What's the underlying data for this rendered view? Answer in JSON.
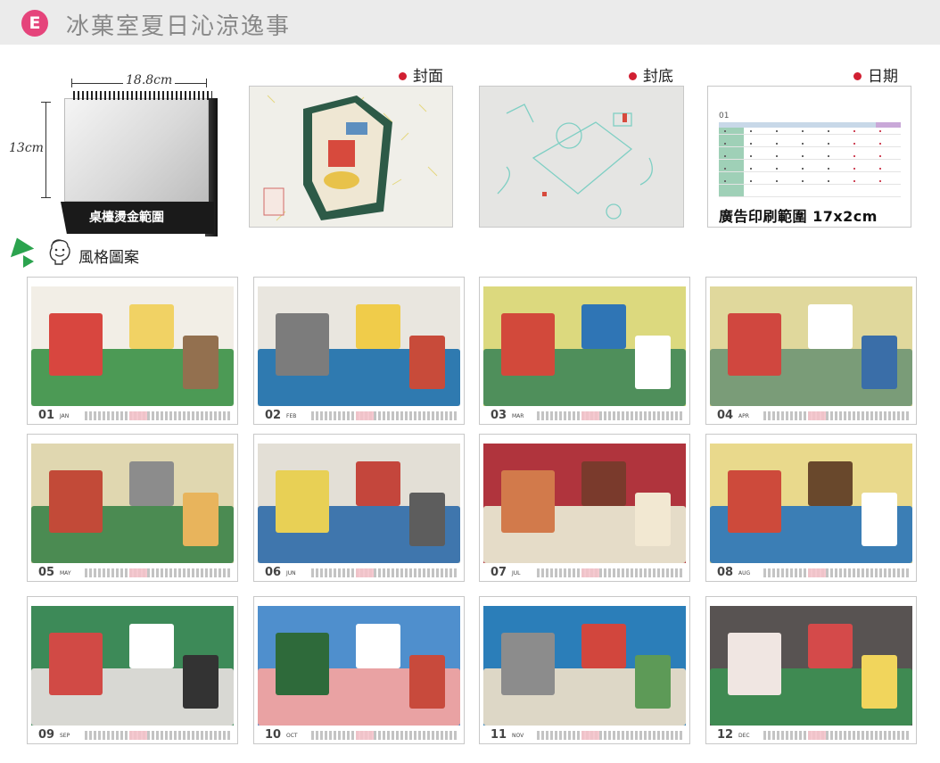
{
  "header": {
    "badge": "E",
    "title": "冰菓室夏日沁涼逸事",
    "badge_color": "#e5447b"
  },
  "desk": {
    "width_label": "18.8cm",
    "height_label": "13cm",
    "base_label": "桌檯燙金範圍"
  },
  "style_section": {
    "label": "風格圖案",
    "icon": "smiley-face-icon"
  },
  "previews": {
    "cover": {
      "label": "封面"
    },
    "back": {
      "label": "封底"
    },
    "date": {
      "label": "日期",
      "mini_month": "01",
      "range_label": "廣告印刷範圍 17x2cm"
    }
  },
  "months": [
    {
      "num": "01",
      "name": "JAN",
      "bg": "#f2eee6",
      "c1": "#4c9a55",
      "c2": "#d8463f",
      "c3": "#f1d264",
      "c4": "#93704f"
    },
    {
      "num": "02",
      "name": "FEB",
      "bg": "#e9e6df",
      "c1": "#2f7ab0",
      "c2": "#7c7c7c",
      "c3": "#f0cc4a",
      "c4": "#c84b3a"
    },
    {
      "num": "03",
      "name": "MAR",
      "bg": "#dcd97e",
      "c1": "#4f8f5b",
      "c2": "#d2493b",
      "c3": "#2f75b5",
      "c4": "#ffffff"
    },
    {
      "num": "04",
      "name": "APR",
      "bg": "#e0d89c",
      "c1": "#7a9c78",
      "c2": "#d0473f",
      "c3": "#ffffff",
      "c4": "#3a6ea8"
    },
    {
      "num": "05",
      "name": "MAY",
      "bg": "#e0d7b0",
      "c1": "#4b8b52",
      "c2": "#c24a38",
      "c3": "#8c8c8c",
      "c4": "#e8b45c"
    },
    {
      "num": "06",
      "name": "JUN",
      "bg": "#e3dfd6",
      "c1": "#3f76ad",
      "c2": "#e8d055",
      "c3": "#c4463c",
      "c4": "#5d5d5d"
    },
    {
      "num": "07",
      "name": "JUL",
      "bg": "#b0343d",
      "c1": "#e5dcc8",
      "c2": "#d27a4b",
      "c3": "#7a3a2c",
      "c4": "#f2e8d2"
    },
    {
      "num": "08",
      "name": "AUG",
      "bg": "#e9d98c",
      "c1": "#3b7eb5",
      "c2": "#cd4a3b",
      "c3": "#69482c",
      "c4": "#ffffff"
    },
    {
      "num": "09",
      "name": "SEP",
      "bg": "#3d8a58",
      "c1": "#d8d8d3",
      "c2": "#d14a45",
      "c3": "#ffffff",
      "c4": "#333333"
    },
    {
      "num": "10",
      "name": "OCT",
      "bg": "#4f8fcd",
      "c1": "#e9a2a3",
      "c2": "#2e6a3a",
      "c3": "#ffffff",
      "c4": "#c84a3c"
    },
    {
      "num": "11",
      "name": "NOV",
      "bg": "#2b7eb9",
      "c1": "#ddd7c6",
      "c2": "#8c8c8c",
      "c3": "#d2463d",
      "c4": "#5d9a57"
    },
    {
      "num": "12",
      "name": "DEC",
      "bg": "#585352",
      "c1": "#3f8a52",
      "c2": "#f0e6e2",
      "c3": "#d44a4a",
      "c4": "#f1d55c"
    }
  ]
}
